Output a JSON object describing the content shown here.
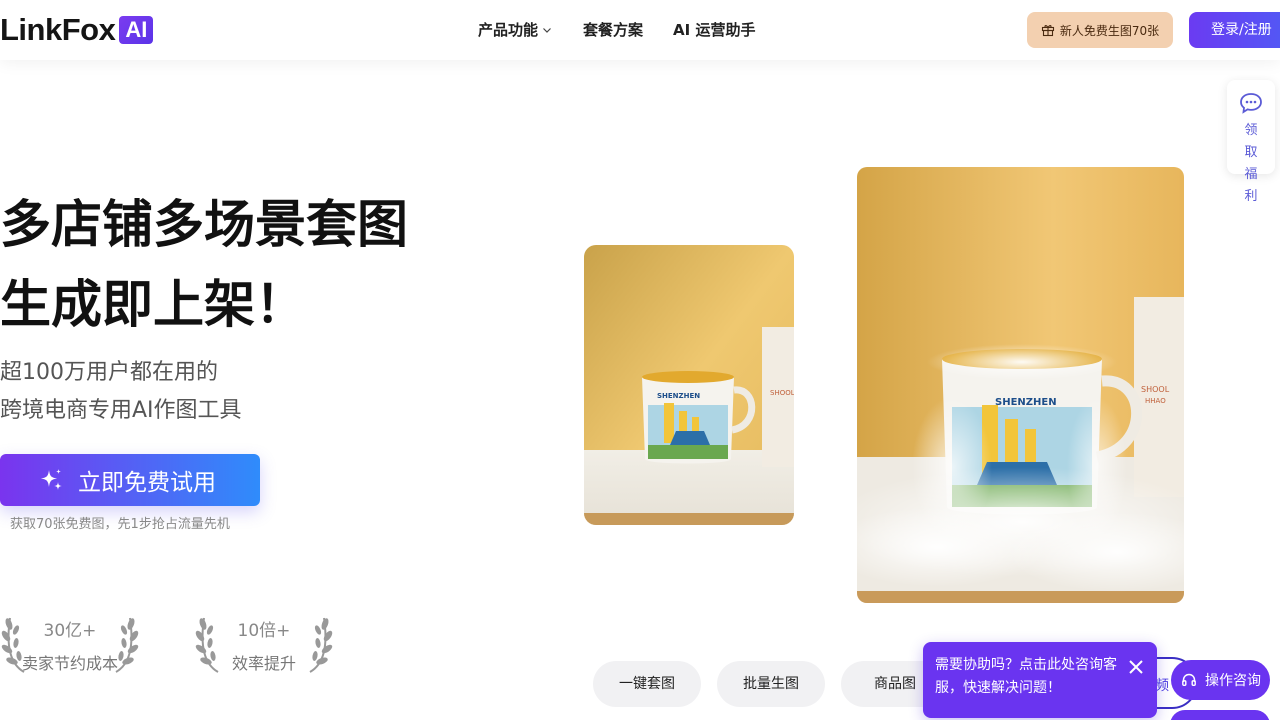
{
  "header": {
    "logo_text": "LinkFox",
    "logo_badge": "AI",
    "nav": [
      {
        "label": "产品功能"
      },
      {
        "label": "套餐方案"
      },
      {
        "label": "AI 运营助手"
      }
    ],
    "gift_button": "新人免费生图70张",
    "login_button": "登录/注册"
  },
  "hero": {
    "title_line1": "多店铺多场景套图",
    "title_line2": "生成即上架！",
    "subtitle_line1": "超100万用户都在用的",
    "subtitle_line2": "跨境电商专用AI作图工具",
    "cta_label": "立即免费试用",
    "cta_note": "获取70张免费图，先1步抢占流量先机"
  },
  "stats": [
    {
      "value": "30亿+",
      "label": "卖家节约成本"
    },
    {
      "value": "10倍+",
      "label": "效率提升"
    }
  ],
  "product": {
    "mug_text": "SHENZHEN",
    "box_text_1": "SHOOL",
    "box_text_2": "HHAO"
  },
  "tabs": [
    {
      "label": "一键套图"
    },
    {
      "label": "批量生图"
    },
    {
      "label": "商品图"
    }
  ],
  "widgets": {
    "welfare_label": "领取福利",
    "help_message": "需要协助吗？点击此处咨询客服，快速解决问题！",
    "ring_text": "频",
    "consult_label": "操作咨询"
  },
  "colors": {
    "brand_purple": "#6a34f0",
    "cta_gradient_start": "#7a34ee",
    "cta_gradient_end": "#2f8cfb",
    "gift_bg": "#f3d0b0"
  }
}
